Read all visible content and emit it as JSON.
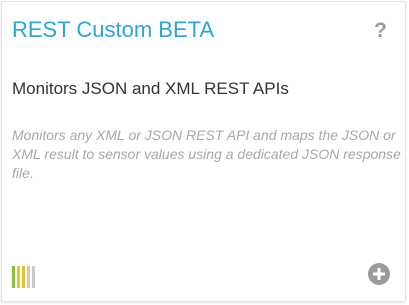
{
  "card": {
    "title": "REST Custom BETA",
    "help_label": "?",
    "subtitle": "Monitors JSON and XML REST APIs",
    "description": "Monitors any XML or JSON REST API and maps the JSON or XML result to sensor values using a dedicated JSON response file.",
    "priority": {
      "level": 5,
      "bar_colors": [
        "#8fbf3a",
        "#d8cd2a",
        "#e6be2a",
        "#c9c9c9",
        "#c9c9c9"
      ]
    },
    "add_icon": "plus-circle-icon"
  },
  "colors": {
    "title": "#2aa6d6",
    "icon_gray": "#9b9b9b",
    "description": "#a8a8a8"
  }
}
